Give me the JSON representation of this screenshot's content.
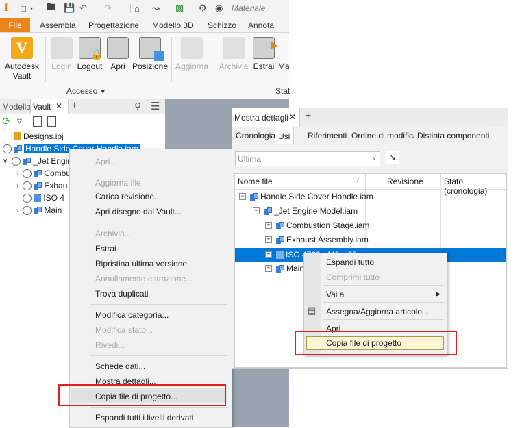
{
  "app": {
    "logo": "I",
    "material": "Materiale"
  },
  "ribbon_tabs": [
    "File",
    "Assembla",
    "Progettazione",
    "Modello 3D",
    "Schizzo",
    "Annota"
  ],
  "ribbon": {
    "vault_label_1": "Autodesk",
    "vault_label_2": "Vault",
    "buttons": [
      "Login",
      "Logout",
      "Apri",
      "Posizione",
      "Aggiorna",
      "Archivia",
      "Estrai",
      "Ma"
    ],
    "group_label": "Accesso",
    "group_label_2": "Stat"
  },
  "left_panel": {
    "tabs": [
      "Modello",
      "Vault"
    ],
    "tree": [
      "Designs.ipj",
      "Handle Side Cover Handle.iam",
      "_Jet Engin",
      "Combus",
      "Exhau",
      "ISO 4",
      "Main"
    ]
  },
  "context_menu_1": {
    "items": [
      "Apri...",
      "Aggiorna file",
      "Carica revisione...",
      "Apri disegno dal Vault...",
      "Archivia...",
      "Estrai",
      "Ripristina ultima versione",
      "Annullamento estrazione...",
      "Trova duplicati",
      "Modifica categoria...",
      "Modifica stato...",
      "Rivedi...",
      "Schede dati...",
      "Mostra dettagli...",
      "Copia file di progetto...",
      "Espandi tutti i livelli derivati"
    ],
    "disabled": [
      0,
      1,
      4,
      7,
      10,
      11
    ]
  },
  "details_panel": {
    "title": "Mostra dettagli",
    "tabs": [
      "Cronologia",
      "Usi",
      "Riferimenti",
      "Ordine di modifica",
      "Distinta componenti"
    ],
    "dropdown_value": "Ultima",
    "columns": [
      "Nome file",
      "Revisione",
      "Stato (cronologia)"
    ],
    "rows": [
      "Handle Side Cover Handle.iam",
      "_Jet Engine Model.iam",
      "Combustion Stage.iam",
      "Exhaust Assembly.iam",
      "ISO 4762 - M6 x 25",
      "Main"
    ]
  },
  "context_menu_2": {
    "items": [
      "Espandi tutto",
      "Comprimi tutto",
      "Vai a",
      "Assegna/Aggiorna articolo...",
      "Apri",
      "Copia file di progetto"
    ],
    "disabled": [
      1
    ]
  },
  "colors": {
    "accent": "#e8841b",
    "selection": "#0078d7",
    "highlight_border": "#e02020"
  }
}
